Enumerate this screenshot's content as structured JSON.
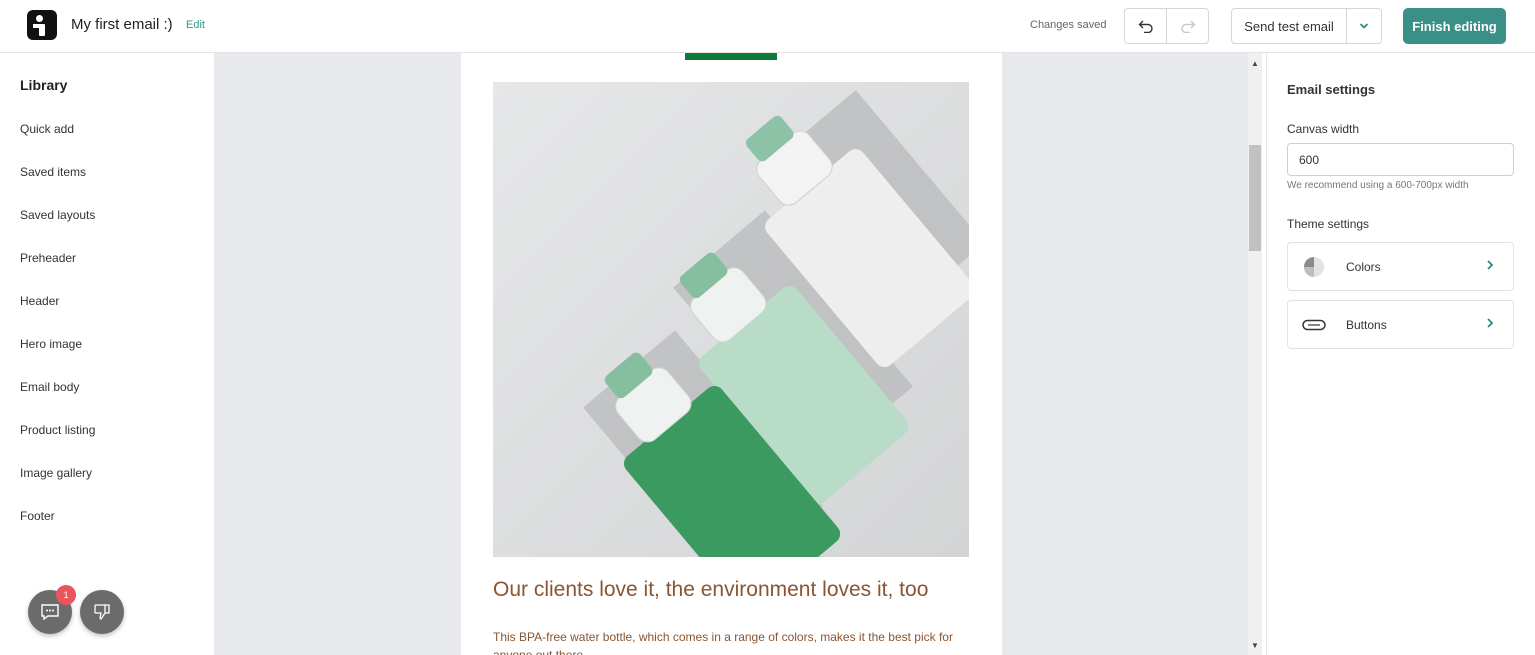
{
  "header": {
    "logo_icon": "brand-logo-icon",
    "title": "My first email :)",
    "edit_label": "Edit",
    "status": "Changes saved",
    "undo_icon": "undo-icon",
    "redo_icon": "redo-icon",
    "send_test_label": "Send test email",
    "finish_label": "Finish editing"
  },
  "library": {
    "title": "Library",
    "items": [
      {
        "label": "Quick add"
      },
      {
        "label": "Saved items"
      },
      {
        "label": "Saved layouts"
      },
      {
        "label": "Preheader"
      },
      {
        "label": "Header"
      },
      {
        "label": "Hero image"
      },
      {
        "label": "Email body"
      },
      {
        "label": "Product listing"
      },
      {
        "label": "Image gallery"
      },
      {
        "label": "Footer"
      }
    ],
    "chat_badge": "1"
  },
  "email": {
    "heading": "Our clients love it, the environment loves it, too",
    "body": "This BPA-free water bottle, which comes in a range of colors, makes it the best pick for anyone out there."
  },
  "settings": {
    "title": "Email settings",
    "canvas_width_label": "Canvas width",
    "canvas_width_value": "600",
    "canvas_width_hint": "We recommend using a 600-700px width",
    "theme_label": "Theme settings",
    "theme_items": [
      {
        "label": "Colors",
        "icon": "palette-icon"
      },
      {
        "label": "Buttons",
        "icon": "button-shape-icon"
      }
    ]
  },
  "colors": {
    "accent": "#3a8f87",
    "edit_link": "#2f9a86",
    "email_text": "#8a5530",
    "badge": "#e8555c"
  }
}
